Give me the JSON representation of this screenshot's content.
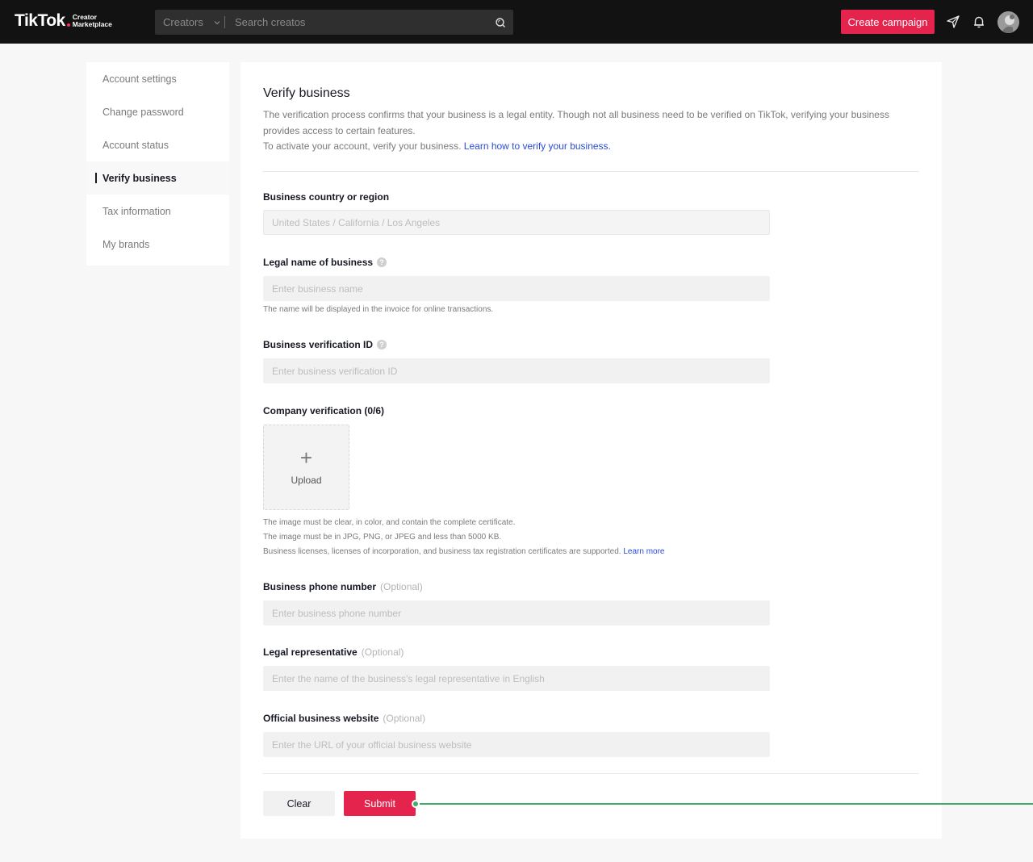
{
  "header": {
    "logo_main": "TikTok",
    "logo_sub_1": "Creator",
    "logo_sub_2": "Marketplace",
    "search_category": "Creators",
    "search_placeholder": "Search creatos",
    "create_campaign": "Create campaign",
    "icons": [
      "search-icon",
      "send-icon",
      "bell-icon",
      "avatar"
    ]
  },
  "sidebar": {
    "items": [
      {
        "label": "Account settings",
        "active": false
      },
      {
        "label": "Change password",
        "active": false
      },
      {
        "label": "Account status",
        "active": false
      },
      {
        "label": "Verify business",
        "active": true
      },
      {
        "label": "Tax information",
        "active": false
      },
      {
        "label": "My brands",
        "active": false
      }
    ]
  },
  "main": {
    "title": "Verify business",
    "description_1": "The verification process confirms that your business is a legal entity. Though not all business need to be verified on TikTok, verifying your business provides access to certain features.",
    "description_2": "To activate your account, verify your business.",
    "description_link": "Learn how to verify your business.",
    "country": {
      "label": "Business country or region",
      "value": "United States / California / Los Angeles"
    },
    "legal_name": {
      "label": "Legal name of business",
      "placeholder": "Enter business name",
      "hint": "The name will be displayed in the invoice for online transactions."
    },
    "verification_id": {
      "label": "Business verification ID",
      "placeholder": "Enter business verification ID"
    },
    "company_verification": {
      "label": "Company verification (0/6)",
      "upload_label": "Upload",
      "hint_1": "The image must be clear, in color, and contain the complete certificate.",
      "hint_2": "The image must be in JPG, PNG, or JPEG and less than 5000 KB.",
      "hint_3": "Business licenses, licenses of incorporation, and business tax registration certificates are supported.",
      "hint_link": "Learn more"
    },
    "phone": {
      "label": "Business phone number",
      "optional": "(Optional)",
      "placeholder": "Enter business phone number"
    },
    "representative": {
      "label": "Legal representative",
      "optional": "(Optional)",
      "placeholder": "Enter the name of the business's legal representative in English"
    },
    "website": {
      "label": "Official business website",
      "optional": "(Optional)",
      "placeholder": "Enter the URL of your official business website"
    },
    "clear_button": "Clear",
    "submit_button": "Submit"
  },
  "colors": {
    "brand": "#e5244e",
    "link": "#2b4ad9",
    "annotation": "#3fae6a"
  }
}
